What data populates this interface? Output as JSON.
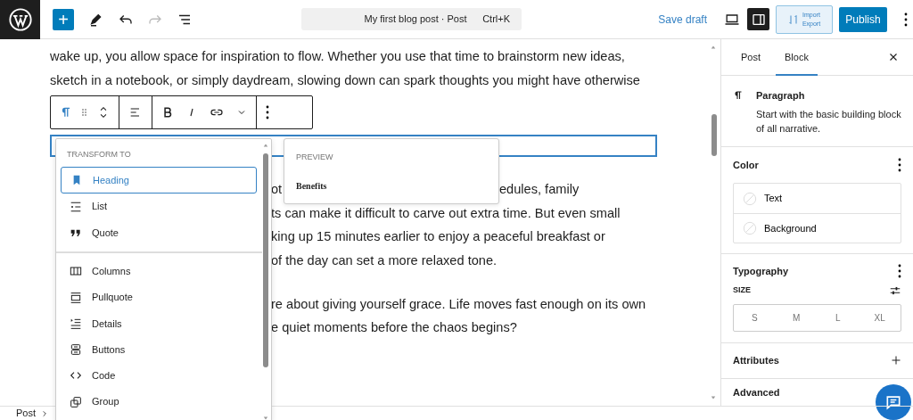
{
  "toolbar": {
    "add_label": "+",
    "command_bar": {
      "title": "My first blog post · Post",
      "shortcut": "Ctrl+K"
    },
    "save_draft": "Save draft",
    "import_export": [
      "Import",
      "Export"
    ],
    "publish": "Publish",
    "redo_disabled": true
  },
  "editor": {
    "lines": [
      {
        "segments": [
          "wake up, you allow space for inspiration to flow. Whether you use that time to brainstorm new ideas,"
        ]
      },
      {
        "segments": [
          "sketch in a notebook, or simply daydream, slowing down can spark thoughts you might have otherwise"
        ]
      },
      {
        "kind": "toolbar"
      },
      {
        "kind": "selected"
      },
      {
        "kind": "after-menu",
        "segments": [
          "ot",
          "edules, family"
        ]
      },
      {
        "kind": "after-menu",
        "segments": [
          "ts can make it difficult to carve out extra time. But even small"
        ]
      },
      {
        "kind": "after-menu",
        "segments": [
          "king up 15 minutes earlier to enjoy a peaceful breakfast or"
        ]
      },
      {
        "kind": "after-menu",
        "segments": [
          "of the day can set a more relaxed tone."
        ]
      },
      {
        "kind": "blank"
      },
      {
        "kind": "after-menu",
        "segments": [
          "re about giving yourself grace. Life moves fast enough on its own"
        ]
      },
      {
        "kind": "after-menu",
        "segments": [
          "e quiet moments before the chaos begins?"
        ]
      },
      {
        "kind": "blank"
      },
      {
        "kind": "blank"
      }
    ]
  },
  "transform_menu": {
    "heading": "TRANSFORM TO",
    "groups": [
      [
        {
          "label": "Heading",
          "selected": true
        },
        {
          "label": "List",
          "selected": false
        },
        {
          "label": "Quote",
          "selected": false
        }
      ],
      [
        {
          "label": "Columns",
          "selected": false
        },
        {
          "label": "Pullquote",
          "selected": false
        },
        {
          "label": "Details",
          "selected": false
        },
        {
          "label": "Buttons",
          "selected": false
        },
        {
          "label": "Code",
          "selected": false
        },
        {
          "label": "Group",
          "selected": false
        }
      ]
    ]
  },
  "preview": {
    "heading": "PREVIEW",
    "text": "Benefits"
  },
  "sidebar": {
    "tabs": [
      {
        "label": "Post",
        "selected": false
      },
      {
        "label": "Block",
        "selected": true
      }
    ],
    "block": {
      "title": "Paragraph",
      "description": "Start with the basic building block of all narrative."
    },
    "color": {
      "title": "Color",
      "items": [
        "Text",
        "Background"
      ]
    },
    "typography": {
      "title": "Typography",
      "size_label": "SIZE",
      "sizes": [
        "S",
        "M",
        "L",
        "XL"
      ]
    },
    "panels": [
      {
        "title": "Attributes"
      },
      {
        "title": "Advanced"
      }
    ]
  },
  "breadcrumb": [
    "Post"
  ]
}
